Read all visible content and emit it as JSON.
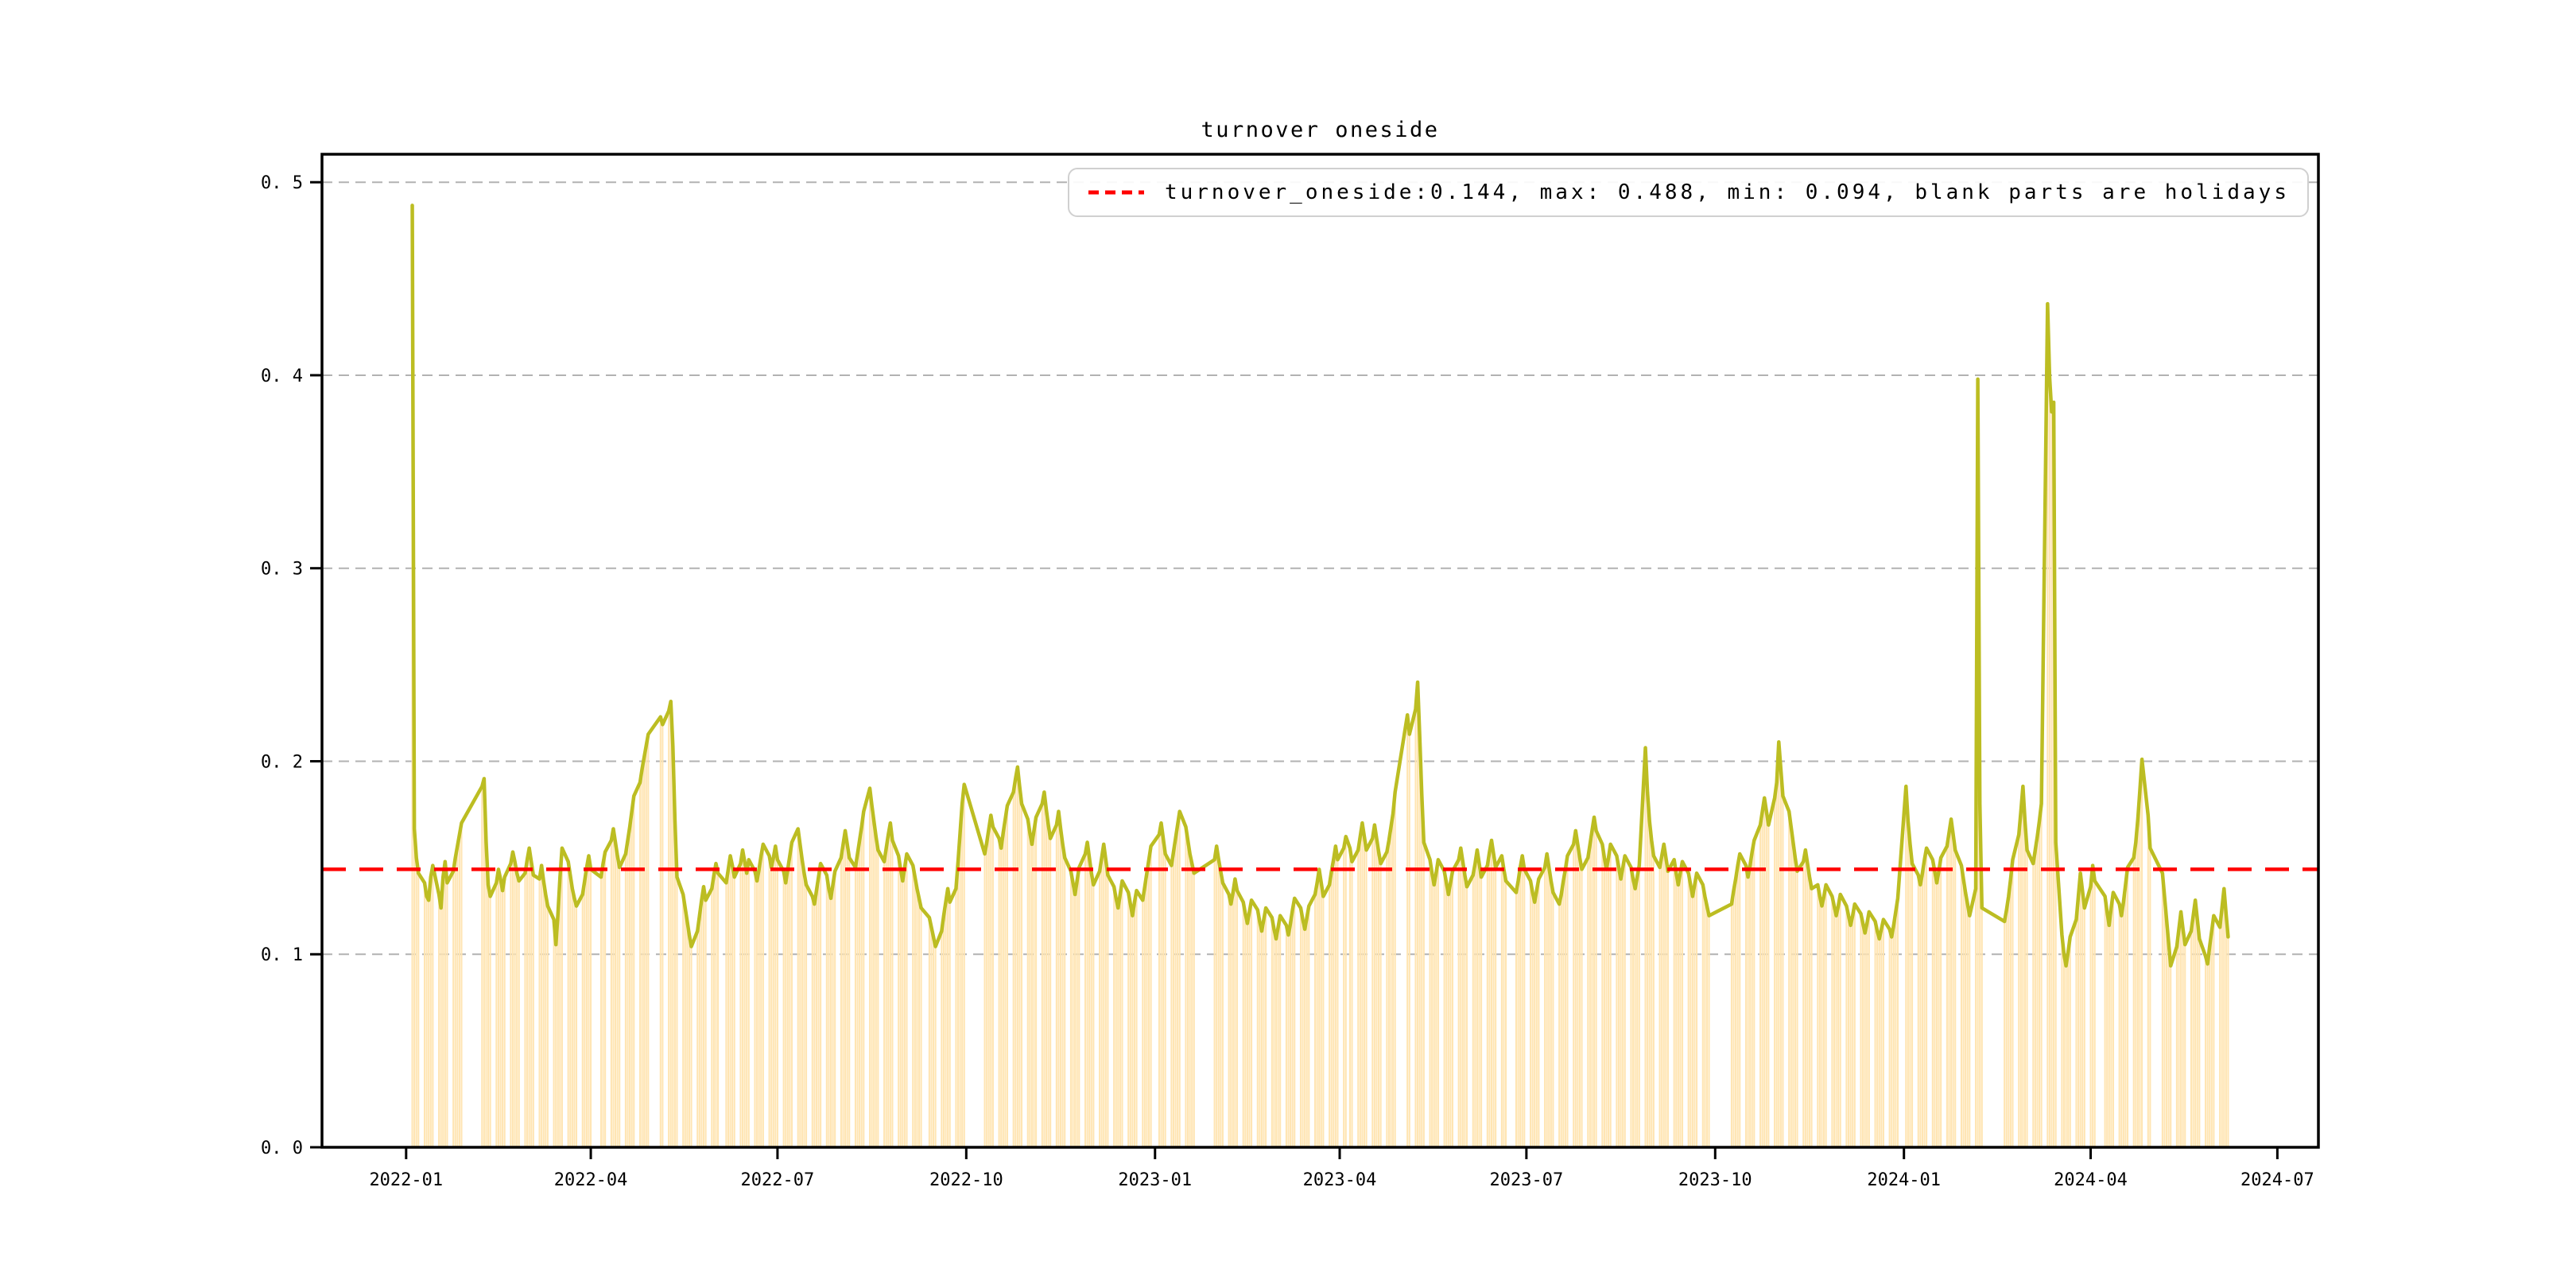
{
  "chart_data": {
    "type": "bar+line",
    "title": "turnover oneside",
    "legend_label": "turnover_oneside:0.144, max: 0.488, min: 0.094, blank parts are holidays",
    "legend_marker": "red-dashed-line",
    "stats": {
      "turnover_oneside": 0.144,
      "max": 0.488,
      "min": 0.094,
      "note": "blank parts are holidays"
    },
    "hline_value": 0.144,
    "colors": {
      "line": "#bcbd22",
      "bar": "#ffe5b3",
      "hline": "#ff0000",
      "grid": "#b2b2b2",
      "spine": "#000000",
      "text": "#000000",
      "legend_border": "#d0d0d0",
      "background": "#ffffff"
    },
    "grid": {
      "horizontal": true,
      "vertical": false,
      "style": "dashed"
    },
    "legend_position": "upper right",
    "y_axis": {
      "min": 0.0,
      "max": 0.5145,
      "ticks": [
        {
          "v": 0.0,
          "label": "0. 0"
        },
        {
          "v": 0.1,
          "label": "0. 1"
        },
        {
          "v": 0.2,
          "label": "0. 2"
        },
        {
          "v": 0.3,
          "label": "0. 3"
        },
        {
          "v": 0.4,
          "label": "0. 4"
        },
        {
          "v": 0.5,
          "label": "0. 5"
        }
      ]
    },
    "x_axis": {
      "start_date": "2022-01-03",
      "min_day": -43,
      "max_day": 930,
      "ticks": [
        {
          "day": -2,
          "label": "2022-01"
        },
        {
          "day": 88,
          "label": "2022-04"
        },
        {
          "day": 179,
          "label": "2022-07"
        },
        {
          "day": 271,
          "label": "2022-10"
        },
        {
          "day": 363,
          "label": "2023-01"
        },
        {
          "day": 453,
          "label": "2023-04"
        },
        {
          "day": 544,
          "label": "2023-07"
        },
        {
          "day": 636,
          "label": "2023-10"
        },
        {
          "day": 728,
          "label": "2024-01"
        },
        {
          "day": 819,
          "label": "2024-04"
        },
        {
          "day": 910,
          "label": "2024-07"
        }
      ]
    },
    "series": {
      "name": "turnover_oneside",
      "frequency": "trading-days (Mon-Fri, null = market holiday)",
      "week_values": [
        [
          null,
          0.488,
          0.165,
          0.15,
          0.142
        ],
        [
          0.137,
          0.13,
          0.128,
          0.14,
          0.146
        ],
        [
          0.131,
          0.124,
          0.14,
          0.148,
          0.137
        ],
        [
          0.143,
          0.15,
          0.156,
          0.162,
          0.168
        ],
        [
          null,
          null,
          null,
          null,
          null
        ],
        [
          0.187,
          0.191,
          0.158,
          0.136,
          0.13
        ],
        [
          0.137,
          0.144,
          0.139,
          0.133,
          0.14
        ],
        [
          0.147,
          0.153,
          0.148,
          0.142,
          0.138
        ],
        [
          0.142,
          0.149,
          0.155,
          0.148,
          0.141
        ],
        [
          0.139,
          0.146,
          0.138,
          0.131,
          0.125
        ],
        [
          0.118,
          0.105,
          0.121,
          0.14,
          0.155
        ],
        [
          0.148,
          0.141,
          0.134,
          0.129,
          0.125
        ],
        [
          0.131,
          0.138,
          0.145,
          0.151,
          0.144
        ],
        [
          null,
          null,
          0.14,
          0.147,
          0.153
        ],
        [
          0.159,
          0.165,
          0.158,
          0.151,
          0.145
        ],
        [
          0.152,
          0.159,
          0.166,
          0.174,
          0.182
        ],
        [
          0.189,
          0.196,
          0.202,
          0.208,
          0.214
        ],
        [
          null,
          null,
          null,
          0.223,
          0.219
        ],
        [
          0.226,
          0.231,
          0.208,
          0.17,
          0.14
        ],
        [
          0.131,
          0.124,
          0.117,
          0.11,
          0.104
        ],
        [
          0.112,
          0.12,
          0.128,
          0.135,
          0.128
        ],
        [
          0.134,
          0.141,
          0.147,
          0.142,
          null
        ],
        [
          0.137,
          0.144,
          0.151,
          0.146,
          0.14
        ],
        [
          0.147,
          0.154,
          0.148,
          0.142,
          0.149
        ],
        [
          0.143,
          0.138,
          0.144,
          0.151,
          0.157
        ],
        [
          0.151,
          0.145,
          0.15,
          0.156,
          0.149
        ],
        [
          0.143,
          0.137,
          0.144,
          0.151,
          0.158
        ],
        [
          0.165,
          0.157,
          0.149,
          0.142,
          0.136
        ],
        [
          0.13,
          0.126,
          0.133,
          0.14,
          0.147
        ],
        [
          0.141,
          0.134,
          0.129,
          0.136,
          0.143
        ],
        [
          0.15,
          0.157,
          0.164,
          0.157,
          0.15
        ],
        [
          0.145,
          0.152,
          0.159,
          0.166,
          0.174
        ],
        [
          0.186,
          0.177,
          0.169,
          0.161,
          0.154
        ],
        [
          0.148,
          0.155,
          0.162,
          0.168,
          0.159
        ],
        [
          0.151,
          0.144,
          0.138,
          0.145,
          0.152
        ],
        [
          0.146,
          0.14,
          0.134,
          0.129,
          0.124
        ],
        [
          null,
          0.119,
          0.114,
          0.109,
          0.104
        ],
        [
          0.112,
          0.12,
          0.127,
          0.134,
          0.127
        ],
        [
          0.134,
          0.148,
          0.163,
          0.178,
          0.188
        ],
        [
          null,
          null,
          null,
          null,
          null
        ],
        [
          0.152,
          0.158,
          0.165,
          0.172,
          0.166
        ],
        [
          0.16,
          0.155,
          0.163,
          0.17,
          0.177
        ],
        [
          0.184,
          0.191,
          0.197,
          0.187,
          0.178
        ],
        [
          0.17,
          0.163,
          0.157,
          0.164,
          0.171
        ],
        [
          0.178,
          0.184,
          0.175,
          0.167,
          0.16
        ],
        [
          0.167,
          0.174,
          0.165,
          0.157,
          0.15
        ],
        [
          0.143,
          0.137,
          0.131,
          0.138,
          0.145
        ],
        [
          0.152,
          0.158,
          0.15,
          0.142,
          0.136
        ],
        [
          0.143,
          0.15,
          0.157,
          0.149,
          0.141
        ],
        [
          0.135,
          0.129,
          0.124,
          0.131,
          0.138
        ],
        [
          0.132,
          0.126,
          0.12,
          0.127,
          0.133
        ],
        [
          0.128,
          0.135,
          0.142,
          0.149,
          0.156
        ],
        [
          null,
          0.162,
          0.168,
          0.16,
          0.152
        ],
        [
          0.146,
          0.153,
          0.16,
          0.167,
          0.174
        ],
        [
          0.166,
          0.159,
          0.152,
          0.147,
          0.142
        ],
        [
          null,
          null,
          null,
          null,
          null
        ],
        [
          0.149,
          0.156,
          0.149,
          0.143,
          0.137
        ],
        [
          0.131,
          0.126,
          0.132,
          0.139,
          0.133
        ],
        [
          0.127,
          0.121,
          0.116,
          0.122,
          0.128
        ],
        [
          0.123,
          0.117,
          0.112,
          0.118,
          0.124
        ],
        [
          0.119,
          0.113,
          0.108,
          0.114,
          0.12
        ],
        [
          0.115,
          0.11,
          0.116,
          0.123,
          0.129
        ],
        [
          0.124,
          0.118,
          0.113,
          0.119,
          0.125
        ],
        [
          0.131,
          0.137,
          0.144,
          0.137,
          0.13
        ],
        [
          0.136,
          0.143,
          0.149,
          0.156,
          0.149
        ],
        [
          0.155,
          0.161,
          null,
          0.155,
          0.148
        ],
        [
          0.154,
          0.161,
          0.168,
          0.161,
          0.154
        ],
        [
          0.16,
          0.167,
          0.16,
          0.153,
          0.147
        ],
        [
          0.153,
          0.159,
          0.166,
          0.173,
          0.184
        ],
        [
          null,
          null,
          null,
          0.224,
          0.214
        ],
        [
          0.227,
          0.241,
          0.213,
          0.183,
          0.158
        ],
        [
          0.149,
          0.142,
          0.136,
          0.142,
          0.149
        ],
        [
          0.143,
          0.137,
          0.131,
          0.137,
          0.143
        ],
        [
          0.149,
          0.155,
          0.148,
          0.141,
          0.135
        ],
        [
          0.141,
          0.147,
          0.154,
          0.147,
          0.14
        ],
        [
          0.146,
          0.153,
          0.159,
          0.152,
          0.145
        ],
        [
          0.151,
          0.144,
          0.138,
          null,
          null
        ],
        [
          0.132,
          0.138,
          0.145,
          0.151,
          0.144
        ],
        [
          0.138,
          0.132,
          0.127,
          0.133,
          0.139
        ],
        [
          0.145,
          0.152,
          0.145,
          0.138,
          0.132
        ],
        [
          0.126,
          0.131,
          0.138,
          0.144,
          0.151
        ],
        [
          0.157,
          0.164,
          0.157,
          0.15,
          0.144
        ],
        [
          0.15,
          0.157,
          0.164,
          0.171,
          0.164
        ],
        [
          0.157,
          0.15,
          0.144,
          0.15,
          0.157
        ],
        [
          0.151,
          0.145,
          0.139,
          0.145,
          0.151
        ],
        [
          0.145,
          0.139,
          0.134,
          0.14,
          0.146
        ],
        [
          0.207,
          0.184,
          0.169,
          0.159,
          0.151
        ],
        [
          0.145,
          0.151,
          0.157,
          0.15,
          0.143
        ],
        [
          0.149,
          0.142,
          0.136,
          0.142,
          0.148
        ],
        [
          0.142,
          0.136,
          0.13,
          0.136,
          0.142
        ],
        [
          0.136,
          0.13,
          0.125,
          0.12,
          null
        ],
        [
          null,
          null,
          null,
          null,
          null
        ],
        [
          0.126,
          0.133,
          0.139,
          0.146,
          0.152
        ],
        [
          0.146,
          0.14,
          0.146,
          0.153,
          0.159
        ],
        [
          0.167,
          0.174,
          0.181,
          0.174,
          0.167
        ],
        [
          0.181,
          0.189,
          0.21,
          0.196,
          0.182
        ],
        [
          0.174,
          0.166,
          0.158,
          0.15,
          0.143
        ],
        [
          0.148,
          0.154,
          0.147,
          0.14,
          0.134
        ],
        [
          0.136,
          0.13,
          0.125,
          0.13,
          0.136
        ],
        [
          0.13,
          0.125,
          0.12,
          0.125,
          0.131
        ],
        [
          0.125,
          0.12,
          0.115,
          0.12,
          0.126
        ],
        [
          0.121,
          0.116,
          0.111,
          0.116,
          0.122
        ],
        [
          0.117,
          0.112,
          0.108,
          0.113,
          0.118
        ],
        [
          0.113,
          0.109,
          0.115,
          0.122,
          0.129
        ],
        [
          null,
          0.187,
          0.169,
          0.157,
          0.147
        ],
        [
          0.141,
          0.136,
          0.142,
          0.149,
          0.155
        ],
        [
          0.149,
          0.143,
          0.137,
          0.143,
          0.15
        ],
        [
          0.156,
          0.163,
          0.17,
          0.162,
          0.154
        ],
        [
          0.146,
          0.139,
          0.132,
          0.126,
          0.12
        ],
        [
          0.134,
          0.398,
          0.178,
          0.124,
          null
        ],
        [
          null,
          null,
          null,
          null,
          null
        ],
        [
          0.117,
          0.123,
          0.13,
          0.139,
          0.149
        ],
        [
          0.162,
          0.174,
          0.187,
          0.169,
          0.154
        ],
        [
          0.147,
          0.154,
          0.161,
          0.169,
          0.178
        ],
        [
          0.437,
          0.399,
          0.381,
          0.386,
          0.158
        ],
        [
          0.11,
          0.1,
          0.094,
          0.101,
          0.109
        ],
        [
          0.118,
          0.13,
          0.142,
          0.133,
          0.124
        ],
        [
          0.135,
          0.146,
          0.138,
          null,
          null
        ],
        [
          0.13,
          0.122,
          0.115,
          0.124,
          0.132
        ],
        [
          0.126,
          0.12,
          0.127,
          0.136,
          0.145
        ],
        [
          0.15,
          0.158,
          0.17,
          0.185,
          0.201
        ],
        [
          0.172,
          0.155,
          null,
          null,
          null
        ],
        [
          0.142,
          0.13,
          0.118,
          0.106,
          0.094
        ],
        [
          0.104,
          0.113,
          0.122,
          0.113,
          0.105
        ],
        [
          0.112,
          0.12,
          0.128,
          0.118,
          0.108
        ],
        [
          0.099,
          0.095,
          0.104,
          0.112,
          0.12
        ],
        [
          0.114,
          0.124,
          0.134,
          0.121,
          0.109
        ]
      ]
    }
  }
}
